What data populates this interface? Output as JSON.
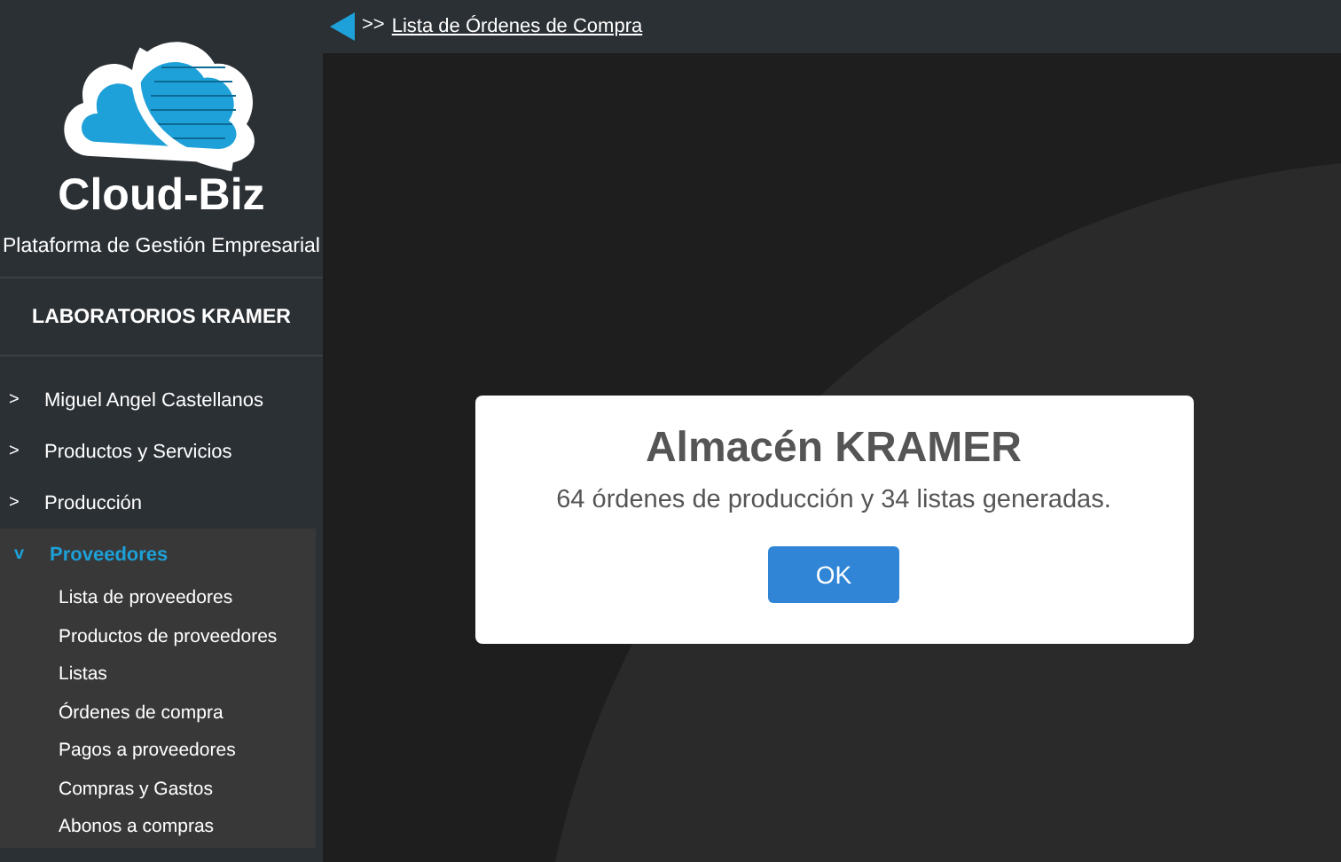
{
  "sidebar": {
    "brand": "Cloud-Biz",
    "tagline": "Plataforma de Gestión Empresarial",
    "company": "LABORATORIOS KRAMER",
    "menu": [
      {
        "marker": ">",
        "label": "Miguel Angel Castellanos",
        "expanded": false
      },
      {
        "marker": ">",
        "label": "Productos y Servicios",
        "expanded": false
      },
      {
        "marker": ">",
        "label": "Producción",
        "expanded": false
      },
      {
        "marker": "v",
        "label": "Proveedores",
        "expanded": true,
        "children": [
          {
            "label": "Lista de proveedores"
          },
          {
            "label": "Productos de proveedores"
          },
          {
            "label": "Listas"
          },
          {
            "label": "Órdenes de compra"
          },
          {
            "label": "Pagos a proveedores"
          },
          {
            "label": "Compras y Gastos"
          },
          {
            "label": "Abonos a compras"
          }
        ]
      }
    ]
  },
  "breadcrumb": {
    "separator": ">>",
    "link": "Lista de Órdenes de Compra"
  },
  "dialog": {
    "title": "Almacén KRAMER",
    "message": "64 órdenes de producción y 34 listas generadas.",
    "button": "OK"
  }
}
